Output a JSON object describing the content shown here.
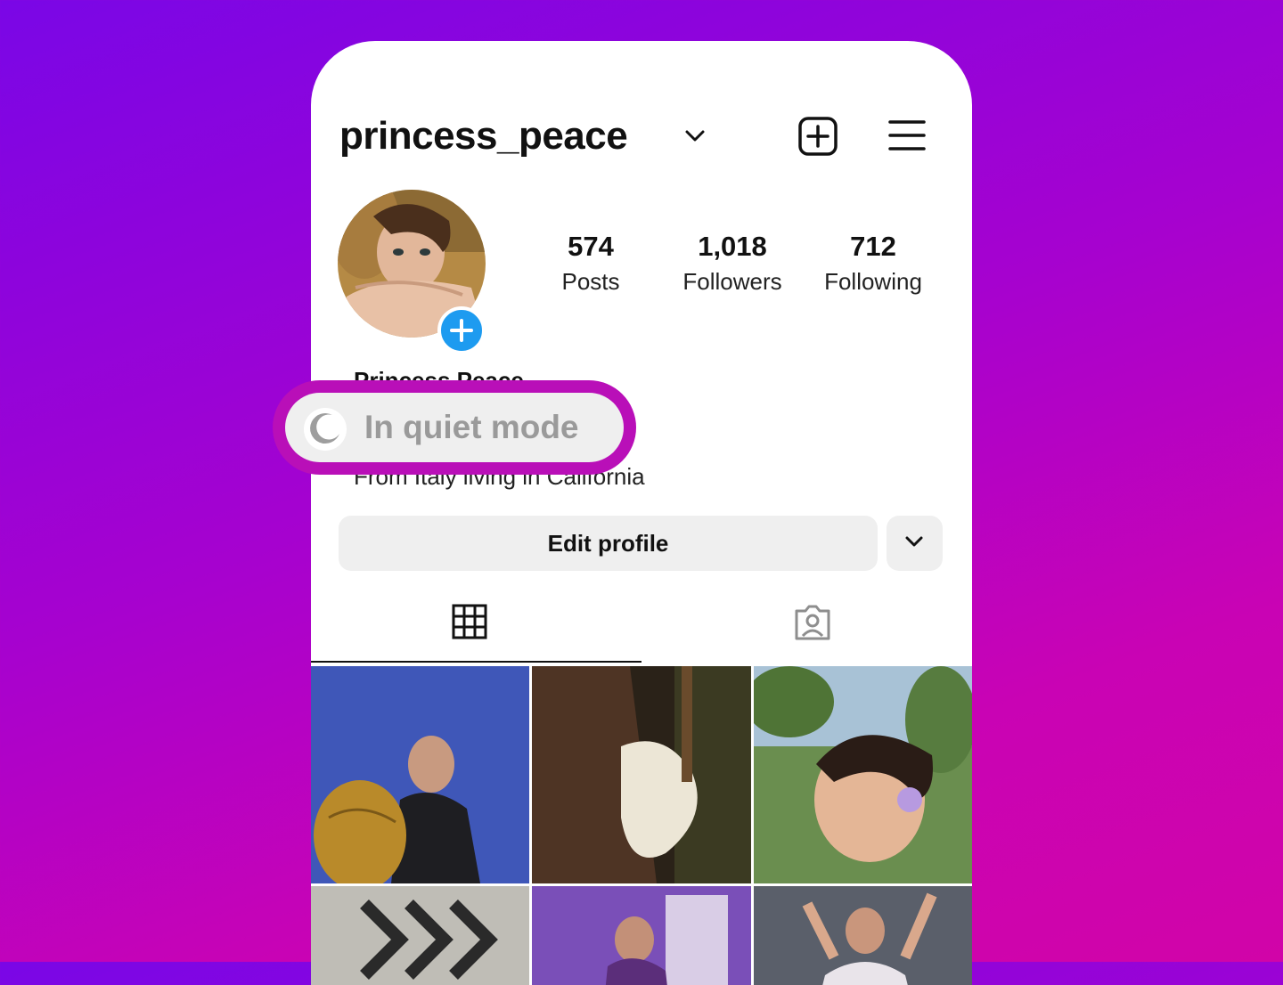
{
  "profile": {
    "username": "princess_peace",
    "name": "Princess Peace",
    "bio": "From Italy living in California",
    "stats": [
      {
        "value": "574",
        "label": "Posts"
      },
      {
        "value": "1,018",
        "label": "Followers"
      },
      {
        "value": "712",
        "label": "Following"
      }
    ]
  },
  "actions": {
    "edit_profile": "Edit profile"
  },
  "status": {
    "quiet_mode": "In quiet mode"
  },
  "icons": {
    "dropdown": "chevron-down-icon",
    "new_post": "plus-square-icon",
    "menu": "hamburger-menu-icon",
    "avatar_add": "plus-circle-icon",
    "grid_tab": "grid-icon",
    "tagged_tab": "person-tag-icon",
    "quiet": "moon-icon"
  },
  "colors": {
    "background_top": "#7a06e6",
    "background_bottom": "#d104a8",
    "highlight": "#b90fb8",
    "avatar_add": "#1d9bf0"
  }
}
